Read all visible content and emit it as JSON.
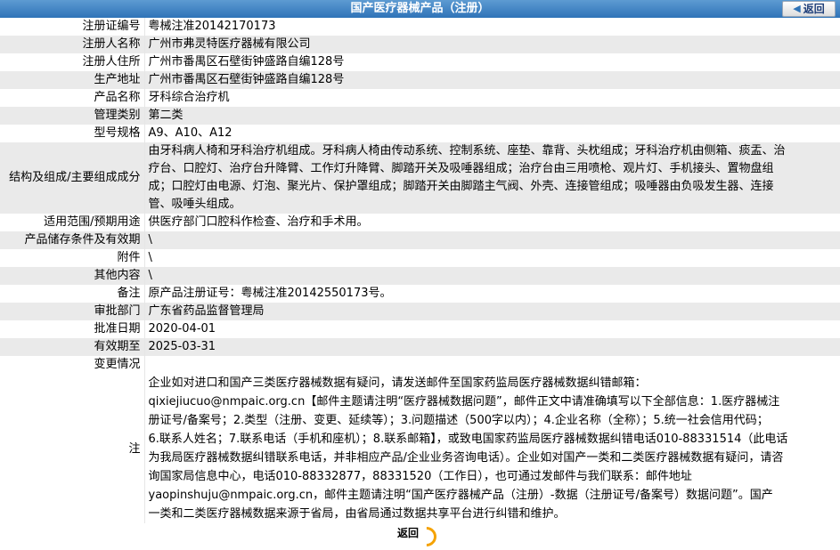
{
  "header": {
    "title": "国产医疗器械产品（注册）",
    "back_label": "返回"
  },
  "rows": [
    {
      "label": "注册证编号",
      "value": "粤械注准20142170173"
    },
    {
      "label": "注册人名称",
      "value": "广州市弗灵特医疗器械有限公司"
    },
    {
      "label": "注册人住所",
      "value": "广州市番禺区石壁街钟盛路自编128号"
    },
    {
      "label": "生产地址",
      "value": "广州市番禺区石壁街钟盛路自编128号"
    },
    {
      "label": "产品名称",
      "value": "牙科综合治疗机"
    },
    {
      "label": "管理类别",
      "value": "第二类"
    },
    {
      "label": "型号规格",
      "value": "A9、A10、A12"
    },
    {
      "label": "结构及组成/主要组成成分",
      "lines": [
        "由牙科病人椅和牙科治疗机组成。牙科病人椅由传动系统、控制系统、座垫、靠背、头枕组成；牙科治疗机由侧箱、痰盂、治",
        "疗台、口腔灯、治疗台升降臂、工作灯升降臂、脚踏开关及吸唾器组成；治疗台由三用喷枪、观片灯、手机接头、置物盘组",
        "成；口腔灯由电源、灯泡、聚光片、保护罩组成；脚踏开关由脚踏主气阀、外壳、连接管组成；吸唾器由负吸发生器、连接",
        "管、吸唾头组成。"
      ]
    },
    {
      "label": "适用范围/预期用途",
      "value": "供医疗部门口腔科作检查、治疗和手术用。"
    },
    {
      "label": "产品储存条件及有效期",
      "value": "\\"
    },
    {
      "label": "附件",
      "value": "\\"
    },
    {
      "label": "其他内容",
      "value": "\\"
    },
    {
      "label": "备注",
      "value": "原产品注册证号：粤械注准20142550173号。"
    },
    {
      "label": "审批部门",
      "value": "广东省药品监督管理局"
    },
    {
      "label": "批准日期",
      "value": "2020-04-01"
    },
    {
      "label": "有效期至",
      "value": "2025-03-31"
    },
    {
      "label": "变更情况",
      "value": ""
    }
  ],
  "note": {
    "label": "注",
    "lines": [
      "企业如对进口和国产三类医疗器械数据有疑问，请发送邮件至国家药监局医疗器械数据纠错邮箱：",
      "qixiejiucuo@nmpaic.org.cn【邮件主题请注明“医疗器械数据问题”，邮件正文中请准确填写以下全部信息：1.医疗器械注",
      "册证号/备案号；2.类型（注册、变更、延续等）；3.问题描述（500字以内）；4.企业名称（全称）；5.统一社会信用代码；",
      "6.联系人姓名；7.联系电话（手机和座机）；8.联系邮箱】，或致电国家药监局医疗器械数据纠错电话010-88331514（此电话",
      "为我局医疗器械数据纠错联系电话，并非相应产品/企业业务咨询电话）。企业如对国产一类和二类医疗器械数据有疑问，请咨",
      "询国家局信息中心，电话010-88332877，88331520（工作日），也可通过发邮件与我们联系：邮件地址",
      "yaopinshuju@nmpaic.org.cn，邮件主题请注明“国产医疗器械产品（注册）-数据（注册证号/备案号）数据问题”。国产",
      "一类和二类医疗器械数据来源于省局，由省局通过数据共享平台进行纠错和维护。"
    ]
  },
  "footer": {
    "back_label": "返回"
  }
}
